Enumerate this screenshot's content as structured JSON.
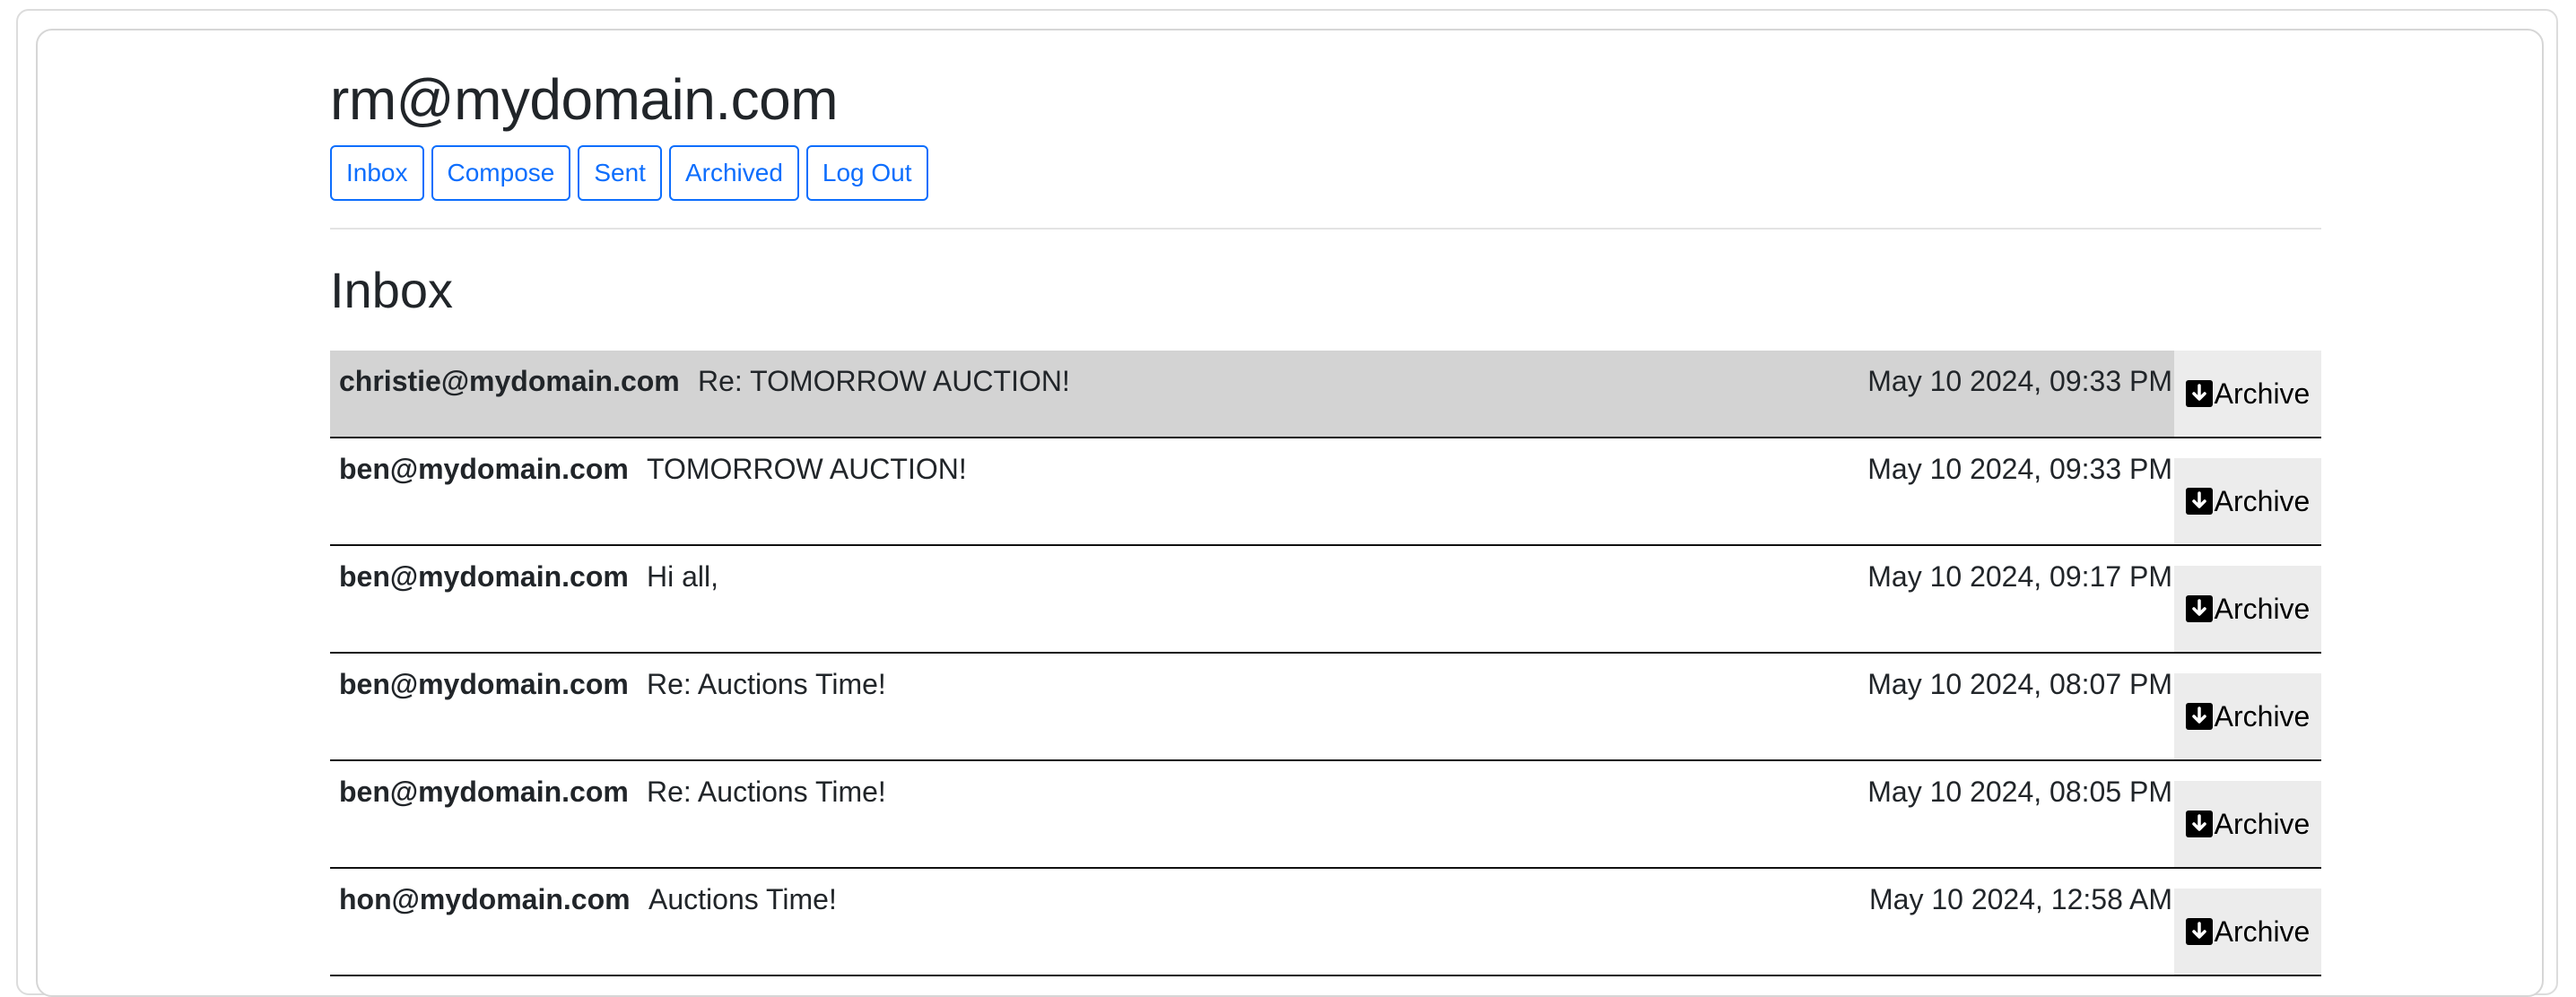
{
  "account": {
    "email": "rm@mydomain.com"
  },
  "nav": {
    "inbox": "Inbox",
    "compose": "Compose",
    "sent": "Sent",
    "archived": "Archived",
    "logout": "Log Out"
  },
  "page": {
    "title": "Inbox"
  },
  "emails": [
    {
      "sender": "christie@mydomain.com",
      "subject": "Re: TOMORROW AUCTION!",
      "date": "May 10 2024, 09:33 PM",
      "action": "Archive",
      "selected": true
    },
    {
      "sender": "ben@mydomain.com",
      "subject": "TOMORROW AUCTION!",
      "date": "May 10 2024, 09:33 PM",
      "action": "Archive",
      "selected": false
    },
    {
      "sender": "ben@mydomain.com",
      "subject": "Hi all,",
      "date": "May 10 2024, 09:17 PM",
      "action": "Archive",
      "selected": false
    },
    {
      "sender": "ben@mydomain.com",
      "subject": "Re: Auctions Time!",
      "date": "May 10 2024, 08:07 PM",
      "action": "Archive",
      "selected": false
    },
    {
      "sender": "ben@mydomain.com",
      "subject": "Re: Auctions Time!",
      "date": "May 10 2024, 08:05 PM",
      "action": "Archive",
      "selected": false
    },
    {
      "sender": "hon@mydomain.com",
      "subject": "Auctions Time!",
      "date": "May 10 2024, 12:58 AM",
      "action": "Archive",
      "selected": false
    }
  ],
  "colors": {
    "accent": "#0d6efd",
    "selected_row": "#d3d3d3",
    "archive_bg": "#ececec"
  },
  "icons": {
    "archive": "download-box-icon"
  }
}
